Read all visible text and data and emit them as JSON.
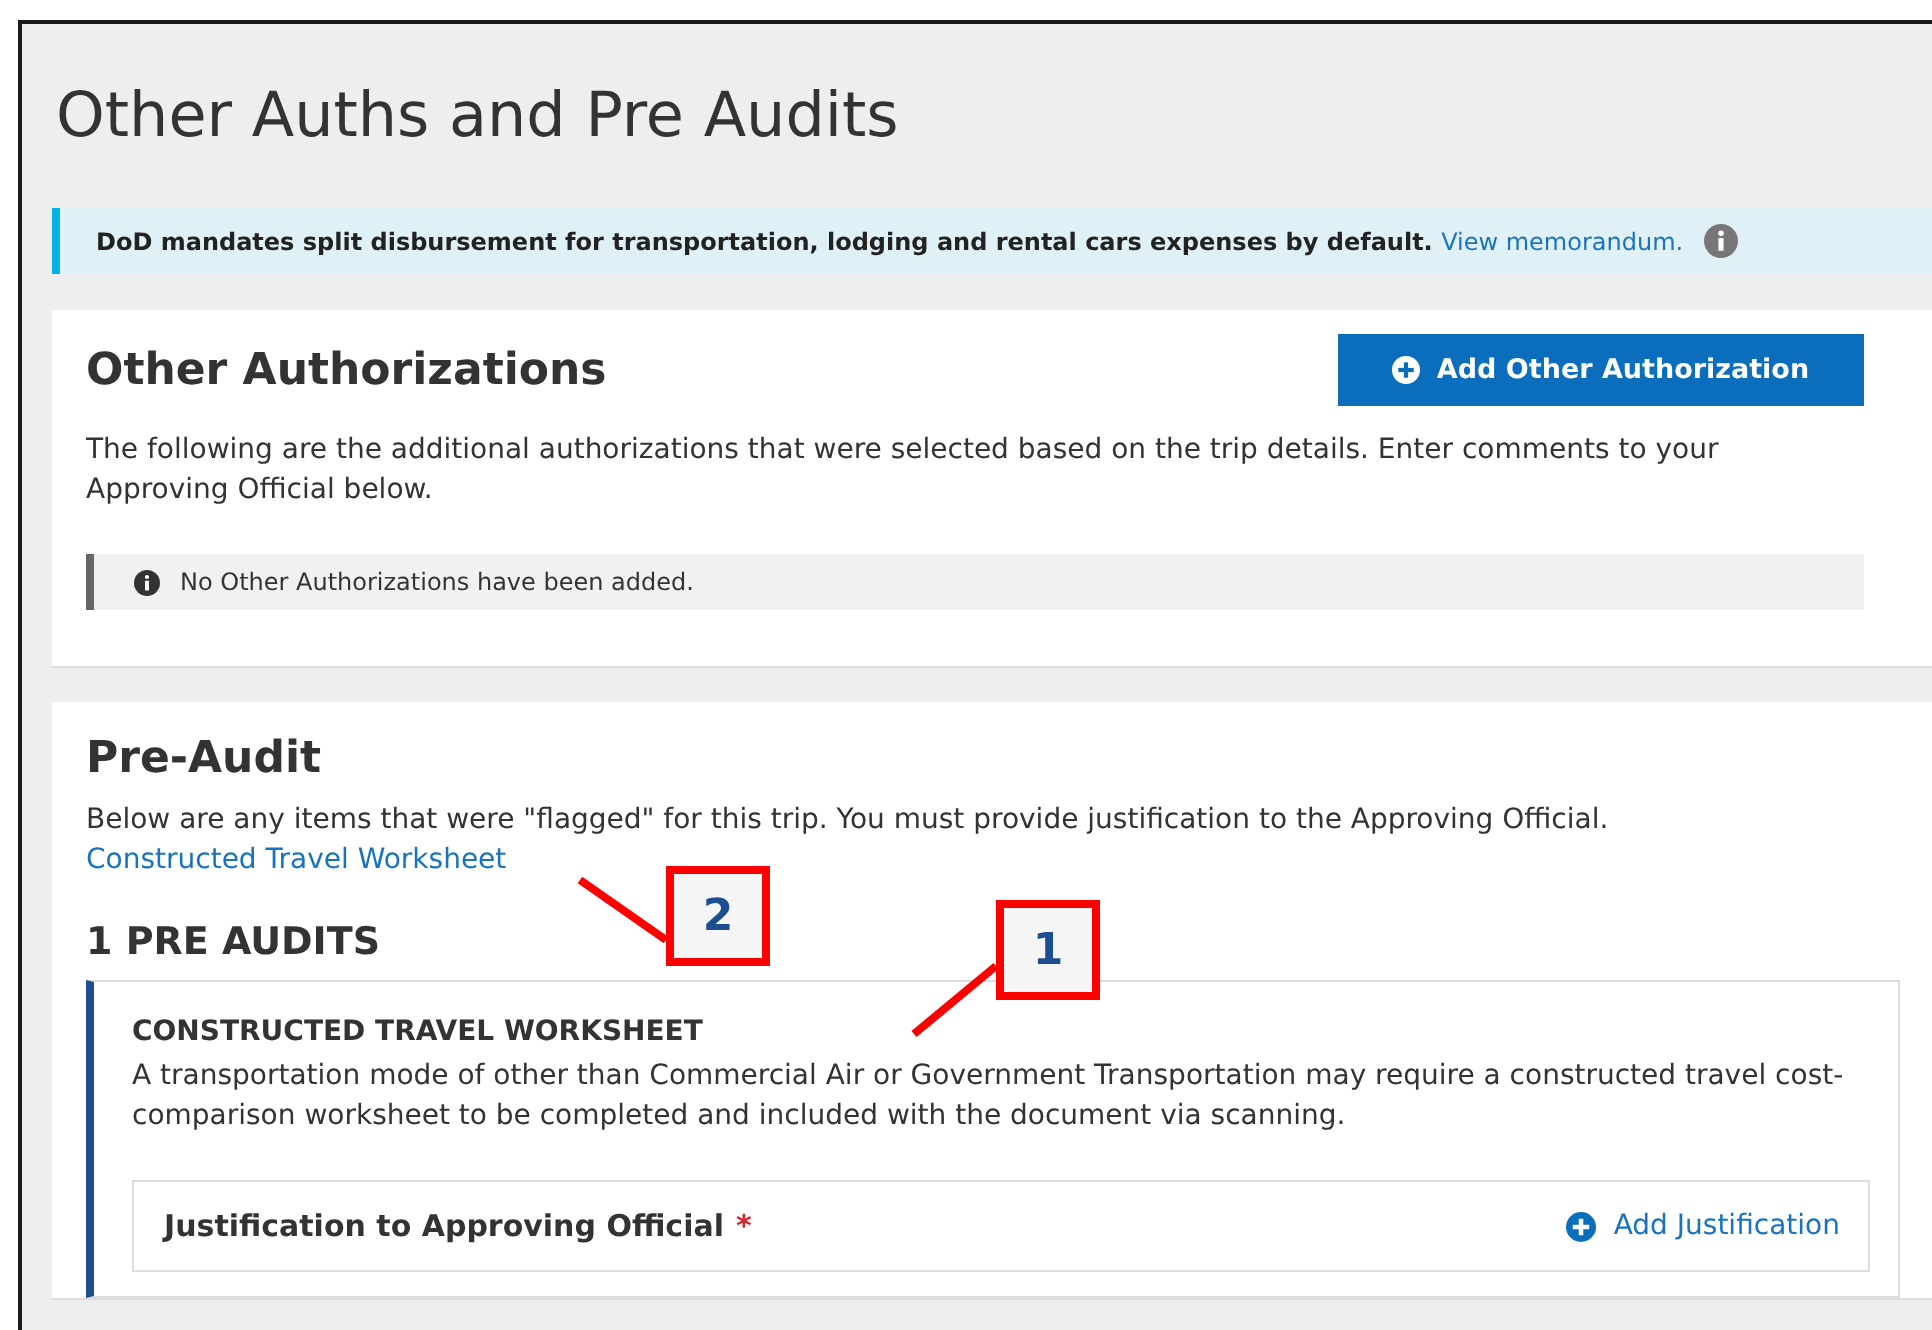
{
  "page": {
    "title": "Other Auths and Pre Audits"
  },
  "banner": {
    "text": "DoD mandates split disbursement for transportation, lodging and rental cars expenses by default.",
    "link": "View memorandum."
  },
  "other_authorizations": {
    "heading": "Other Authorizations",
    "add_button": "Add Other Authorization",
    "description": "The following are the additional authorizations that were selected based on the trip details. Enter comments to your Approving Official below.",
    "empty_notice": "No Other Authorizations have been added."
  },
  "pre_audit": {
    "heading": "Pre-Audit",
    "description": "Below are any items that were \"flagged\" for this trip. You must provide justification to the Approving Official.",
    "link": "Constructed Travel Worksheet",
    "count_heading": "1 PRE AUDITS",
    "items": [
      {
        "title": "CONSTRUCTED TRAVEL WORKSHEET",
        "description": "A transportation mode of other than Commercial Air or Government Transportation may require a constructed travel cost-comparison worksheet to be completed and included with the document via scanning.",
        "justification": {
          "label": "Justification to Approving Official",
          "required_mark": "*",
          "action": "Add Justification"
        }
      }
    ]
  },
  "callouts": [
    {
      "label": "2"
    },
    {
      "label": "1"
    }
  ]
}
